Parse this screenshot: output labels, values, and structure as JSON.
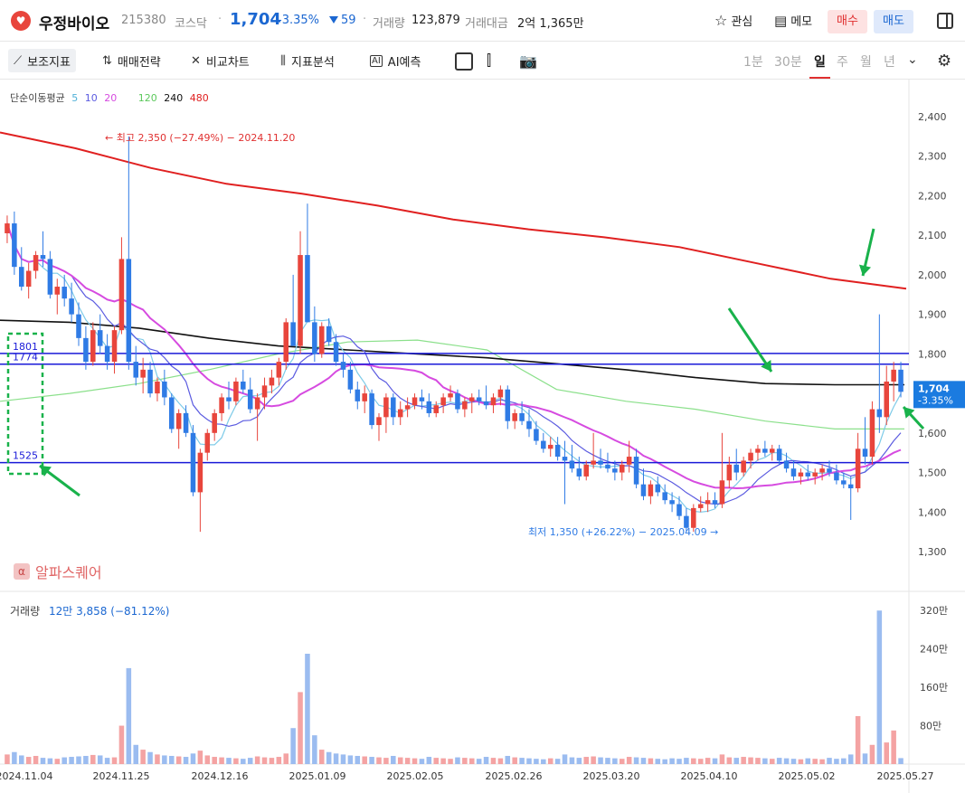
{
  "header": {
    "name": "우정바이오",
    "code": "215380",
    "market": "코스닥",
    "price": "1,704",
    "change_pct": "-3.35%",
    "change": "59",
    "volume_label": "거래량",
    "volume": "123,879",
    "amount_label": "거래대금",
    "amount": "2억 1,365만",
    "watch": "관심",
    "memo": "메모",
    "buy": "매수",
    "sell": "매도"
  },
  "toolbar": {
    "items": [
      "보조지표",
      "매매전략",
      "비교차트",
      "지표분석",
      "AI예측"
    ],
    "periods": [
      "1분",
      "30분",
      "일",
      "주",
      "월",
      "년"
    ],
    "active_period": "일"
  },
  "colors": {
    "up": "#e8453c",
    "down": "#2f7be5",
    "ma5": "#7ecbe8",
    "ma10": "#5b5be0",
    "ma20": "#d64be0",
    "ma120": "#8be08b",
    "ma240": "#111111",
    "ma480": "#e02020",
    "hline": "#1a1ad8",
    "price_badge": "#1b7be0"
  },
  "ma_legend": {
    "title": "단순이동평균",
    "p5": "5",
    "p10": "10",
    "p20": "20",
    "p120": "120",
    "p240": "240",
    "p480": "480"
  },
  "watermark": "알파스퀘어",
  "chart_data": [
    {
      "type": "candlestick",
      "y_ticks": [
        "2,400",
        "2,300",
        "2,200",
        "2,100",
        "2,000",
        "1,900",
        "1,800",
        "1,700",
        "1,600",
        "1,500",
        "1,400",
        "1,300"
      ],
      "x_ticks": [
        "2024.11.04",
        "2024.11.25",
        "2024.12.16",
        "2025.01.09",
        "2025.02.05",
        "2025.02.26",
        "2025.03.20",
        "2025.04.10",
        "2025.05.02",
        "2025.05.27"
      ],
      "ylim": [
        1255,
        2500
      ],
      "last_price_label": "1,704",
      "last_pct_label": "-3.35%",
      "horizontal_lines": [
        1801,
        1774,
        1525
      ],
      "hline_labels": [
        "1801",
        "1774",
        "1525"
      ],
      "high_annotation": "← 최고 2,350 (−27.49%) − 2024.11.20",
      "low_annotation": "최저 1,350 (+26.22%) − 2025.04.09 →",
      "ma240": [
        1885,
        1880,
        1865,
        1840,
        1820,
        1810,
        1800,
        1790,
        1775,
        1760,
        1740,
        1725,
        1722,
        1722
      ],
      "ma120": [
        1680,
        1700,
        1725,
        1760,
        1800,
        1830,
        1835,
        1810,
        1710,
        1680,
        1660,
        1630,
        1610,
        1610
      ],
      "ma480": [
        2360,
        2320,
        2270,
        2230,
        2205,
        2175,
        2140,
        2115,
        2095,
        2070,
        2030,
        1990,
        1965
      ],
      "ohlc": [
        [
          2105,
          2150,
          2080,
          2130
        ],
        [
          2130,
          2160,
          2000,
          2020
        ],
        [
          2020,
          2070,
          1960,
          1970
        ],
        [
          1970,
          2030,
          1940,
          2010
        ],
        [
          2010,
          2060,
          1990,
          2050
        ],
        [
          2050,
          2110,
          2020,
          2040
        ],
        [
          2040,
          2060,
          1940,
          1950
        ],
        [
          1950,
          1990,
          1900,
          1970
        ],
        [
          1970,
          2000,
          1920,
          1940
        ],
        [
          1940,
          1980,
          1880,
          1900
        ],
        [
          1900,
          1930,
          1820,
          1840
        ],
        [
          1840,
          1870,
          1760,
          1780
        ],
        [
          1780,
          1880,
          1770,
          1860
        ],
        [
          1860,
          1900,
          1800,
          1820
        ],
        [
          1820,
          1850,
          1760,
          1780
        ],
        [
          1780,
          1870,
          1750,
          1860
        ],
        [
          1860,
          2095,
          1850,
          2040
        ],
        [
          2040,
          2350,
          1760,
          1780
        ],
        [
          1780,
          1820,
          1720,
          1740
        ],
        [
          1740,
          1790,
          1700,
          1760
        ],
        [
          1760,
          1780,
          1690,
          1700
        ],
        [
          1700,
          1740,
          1680,
          1730
        ],
        [
          1730,
          1760,
          1670,
          1690
        ],
        [
          1690,
          1700,
          1600,
          1610
        ],
        [
          1610,
          1660,
          1560,
          1650
        ],
        [
          1650,
          1670,
          1590,
          1600
        ],
        [
          1600,
          1620,
          1440,
          1450
        ],
        [
          1450,
          1560,
          1350,
          1550
        ],
        [
          1550,
          1610,
          1530,
          1600
        ],
        [
          1600,
          1660,
          1580,
          1650
        ],
        [
          1650,
          1700,
          1630,
          1690
        ],
        [
          1690,
          1730,
          1660,
          1680
        ],
        [
          1680,
          1740,
          1670,
          1730
        ],
        [
          1730,
          1760,
          1700,
          1710
        ],
        [
          1710,
          1740,
          1650,
          1660
        ],
        [
          1660,
          1700,
          1580,
          1690
        ],
        [
          1690,
          1740,
          1660,
          1720
        ],
        [
          1720,
          1760,
          1700,
          1740
        ],
        [
          1740,
          1790,
          1720,
          1780
        ],
        [
          1780,
          1890,
          1760,
          1880
        ],
        [
          1880,
          2000,
          1840,
          1820
        ],
        [
          1820,
          2110,
          1800,
          2050
        ],
        [
          2050,
          2180,
          1900,
          1880
        ],
        [
          1880,
          1920,
          1780,
          1800
        ],
        [
          1800,
          1880,
          1790,
          1870
        ],
        [
          1870,
          1890,
          1820,
          1830
        ],
        [
          1830,
          1850,
          1770,
          1780
        ],
        [
          1780,
          1800,
          1740,
          1760
        ],
        [
          1760,
          1780,
          1700,
          1710
        ],
        [
          1710,
          1730,
          1660,
          1680
        ],
        [
          1680,
          1720,
          1650,
          1700
        ],
        [
          1700,
          1710,
          1610,
          1620
        ],
        [
          1620,
          1650,
          1580,
          1640
        ],
        [
          1640,
          1700,
          1600,
          1690
        ],
        [
          1690,
          1700,
          1620,
          1640
        ],
        [
          1640,
          1680,
          1620,
          1660
        ],
        [
          1660,
          1690,
          1640,
          1670
        ],
        [
          1670,
          1700,
          1660,
          1690
        ],
        [
          1690,
          1710,
          1660,
          1680
        ],
        [
          1680,
          1700,
          1640,
          1650
        ],
        [
          1650,
          1680,
          1640,
          1670
        ],
        [
          1670,
          1700,
          1650,
          1690
        ],
        [
          1690,
          1720,
          1680,
          1700
        ],
        [
          1700,
          1710,
          1650,
          1660
        ],
        [
          1660,
          1690,
          1640,
          1680
        ],
        [
          1680,
          1700,
          1650,
          1690
        ],
        [
          1690,
          1710,
          1670,
          1680
        ],
        [
          1680,
          1720,
          1660,
          1670
        ],
        [
          1670,
          1700,
          1650,
          1690
        ],
        [
          1690,
          1720,
          1670,
          1710
        ],
        [
          1710,
          1720,
          1610,
          1630
        ],
        [
          1630,
          1660,
          1610,
          1650
        ],
        [
          1650,
          1680,
          1620,
          1630
        ],
        [
          1630,
          1660,
          1590,
          1610
        ],
        [
          1610,
          1630,
          1570,
          1580
        ],
        [
          1580,
          1600,
          1550,
          1560
        ],
        [
          1560,
          1590,
          1540,
          1570
        ],
        [
          1570,
          1590,
          1530,
          1540
        ],
        [
          1540,
          1580,
          1420,
          1530
        ],
        [
          1530,
          1570,
          1500,
          1510
        ],
        [
          1510,
          1540,
          1480,
          1490
        ],
        [
          1490,
          1530,
          1480,
          1520
        ],
        [
          1520,
          1600,
          1510,
          1530
        ],
        [
          1530,
          1560,
          1510,
          1520
        ],
        [
          1520,
          1550,
          1500,
          1510
        ],
        [
          1510,
          1530,
          1480,
          1500
        ],
        [
          1500,
          1530,
          1480,
          1520
        ],
        [
          1520,
          1580,
          1500,
          1540
        ],
        [
          1540,
          1560,
          1460,
          1470
        ],
        [
          1470,
          1510,
          1430,
          1440
        ],
        [
          1440,
          1480,
          1420,
          1470
        ],
        [
          1470,
          1490,
          1440,
          1450
        ],
        [
          1450,
          1470,
          1420,
          1430
        ],
        [
          1430,
          1450,
          1400,
          1420
        ],
        [
          1420,
          1440,
          1380,
          1390
        ],
        [
          1390,
          1410,
          1350,
          1360
        ],
        [
          1360,
          1420,
          1350,
          1410
        ],
        [
          1410,
          1440,
          1400,
          1420
        ],
        [
          1420,
          1450,
          1400,
          1430
        ],
        [
          1430,
          1450,
          1410,
          1420
        ],
        [
          1420,
          1600,
          1410,
          1480
        ],
        [
          1480,
          1540,
          1460,
          1520
        ],
        [
          1520,
          1560,
          1480,
          1500
        ],
        [
          1500,
          1540,
          1490,
          1530
        ],
        [
          1530,
          1560,
          1510,
          1550
        ],
        [
          1550,
          1570,
          1530,
          1560
        ],
        [
          1560,
          1580,
          1540,
          1550
        ],
        [
          1550,
          1570,
          1530,
          1560
        ],
        [
          1560,
          1570,
          1520,
          1530
        ],
        [
          1530,
          1550,
          1500,
          1510
        ],
        [
          1510,
          1530,
          1480,
          1490
        ],
        [
          1490,
          1510,
          1470,
          1500
        ],
        [
          1500,
          1520,
          1480,
          1490
        ],
        [
          1490,
          1510,
          1470,
          1500
        ],
        [
          1500,
          1520,
          1480,
          1510
        ],
        [
          1510,
          1530,
          1490,
          1500
        ],
        [
          1500,
          1520,
          1470,
          1480
        ],
        [
          1480,
          1500,
          1460,
          1470
        ],
        [
          1470,
          1490,
          1380,
          1460
        ],
        [
          1460,
          1600,
          1450,
          1560
        ],
        [
          1560,
          1640,
          1520,
          1540
        ],
        [
          1540,
          1680,
          1520,
          1660
        ],
        [
          1660,
          1900,
          1600,
          1640
        ],
        [
          1640,
          1770,
          1620,
          1730
        ],
        [
          1730,
          1780,
          1680,
          1760
        ],
        [
          1760,
          1780,
          1690,
          1704
        ]
      ]
    },
    {
      "type": "bar",
      "name": "거래량",
      "legend_value": "12만 3,858 (−81.12%)",
      "y_ticks": [
        "320만",
        "240만",
        "160만",
        "80만"
      ],
      "ylim": [
        0,
        3600000
      ],
      "volumes": [
        200000,
        250000,
        180000,
        150000,
        170000,
        130000,
        120000,
        110000,
        140000,
        150000,
        160000,
        170000,
        190000,
        180000,
        130000,
        140000,
        800000,
        2000000,
        400000,
        300000,
        250000,
        200000,
        180000,
        170000,
        160000,
        150000,
        220000,
        280000,
        180000,
        150000,
        140000,
        130000,
        120000,
        110000,
        130000,
        160000,
        140000,
        130000,
        150000,
        220000,
        750000,
        1500000,
        2300000,
        600000,
        300000,
        250000,
        220000,
        200000,
        180000,
        170000,
        160000,
        150000,
        140000,
        130000,
        170000,
        140000,
        130000,
        120000,
        110000,
        150000,
        130000,
        120000,
        110000,
        140000,
        130000,
        120000,
        110000,
        150000,
        130000,
        120000,
        170000,
        140000,
        130000,
        120000,
        110000,
        100000,
        120000,
        110000,
        200000,
        140000,
        130000,
        150000,
        160000,
        140000,
        130000,
        120000,
        110000,
        150000,
        140000,
        130000,
        120000,
        110000,
        100000,
        120000,
        110000,
        130000,
        120000,
        110000,
        130000,
        120000,
        200000,
        140000,
        130000,
        150000,
        140000,
        130000,
        120000,
        110000,
        130000,
        120000,
        110000,
        100000,
        120000,
        110000,
        100000,
        130000,
        110000,
        120000,
        200000,
        1000000,
        220000,
        400000,
        3200000,
        450000,
        700000,
        124000
      ]
    }
  ]
}
